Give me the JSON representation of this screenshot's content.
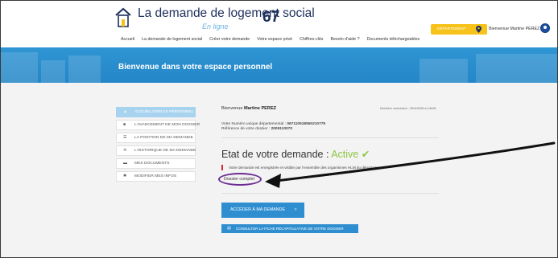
{
  "header": {
    "logo_title": "La demande de logement social",
    "logo_number": "67",
    "logo_subtitle": "En ligne",
    "nav": [
      "Accueil",
      "La demande de logement social",
      "Créer votre demande",
      "Votre espace privé",
      "Chiffres-clés",
      "Besoin d'aide ?",
      "Documents téléchargeables"
    ],
    "department_label": "DÉPARTEMENT",
    "welcome": "Bienvenue Martine PEREZ"
  },
  "banner": {
    "title": "Bienvenue dans votre espace personnel"
  },
  "sidebar": {
    "items": [
      {
        "label": "ACCUEIL ESPACE PERSONNEL",
        "icon": "▲"
      },
      {
        "label": "L'AVANCEMENT DE MON DOSSIER",
        "icon": "■"
      },
      {
        "label": "LA POSITION DE MA DEMANDE",
        "icon": "☰"
      },
      {
        "label": "L'HISTORIQUE DE MA DEMANDE",
        "icon": "⟲"
      },
      {
        "label": "MES DOCUMENTS",
        "icon": "▬"
      },
      {
        "label": "MODIFIER MES INFOS",
        "icon": "✱"
      }
    ]
  },
  "main": {
    "greeting_prefix": "Bienvenue",
    "greeting_name": "Martine PEREZ",
    "last_connection": "Dernière connexion : 20/4/2026 à 14h26",
    "unique_number_label": "Votre Numéro unique départemental : ",
    "unique_number": "067110518550210779",
    "reference_label": "Référence de votre dossier : ",
    "reference": "2009110070",
    "status_label": "Etat de votre demande :",
    "status_value": "Active",
    "status_check": "✔",
    "note": "Votre demande est enregistrée et visible par l'ensemble des organismes HLM du département",
    "dossier_status": "Dossier complet",
    "access_button": "ACCÉDER À MA DEMANDE",
    "access_arrow": ">",
    "summary_button": "CONSULTER LA FICHE RÉCAPITULATIVE DE VOTRE DOSSIER"
  },
  "colors": {
    "accent_blue": "#2f8ed0",
    "banner_blue": "#2f95d3",
    "status_green": "#8cc63f",
    "department_yellow": "#f7c21a",
    "annotation_purple": "#6a2c91"
  }
}
